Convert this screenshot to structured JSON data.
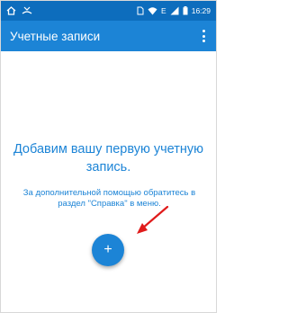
{
  "status_bar": {
    "network_label": "E",
    "clock": "16:29",
    "icons": [
      "home-icon",
      "missed-call-icon",
      "sim-card-icon",
      "wifi-icon",
      "cellular-signal-icon",
      "battery-icon"
    ]
  },
  "app_bar": {
    "title": "Учетные записи",
    "menu_icon": "more-vertical-icon"
  },
  "empty_state": {
    "title": "Добавим вашу первую учетную запись.",
    "hint": "За дополнительной помощью обратитесь в раздел \"Справка\" в меню."
  },
  "fab": {
    "label": "+",
    "icon": "plus-icon"
  },
  "annotation": {
    "icon": "red-arrow-icon",
    "color": "#e01b1b"
  },
  "colors": {
    "status_bar": "#0d6dbd",
    "app_bar": "#1c84d6",
    "accent": "#1c84d6"
  }
}
